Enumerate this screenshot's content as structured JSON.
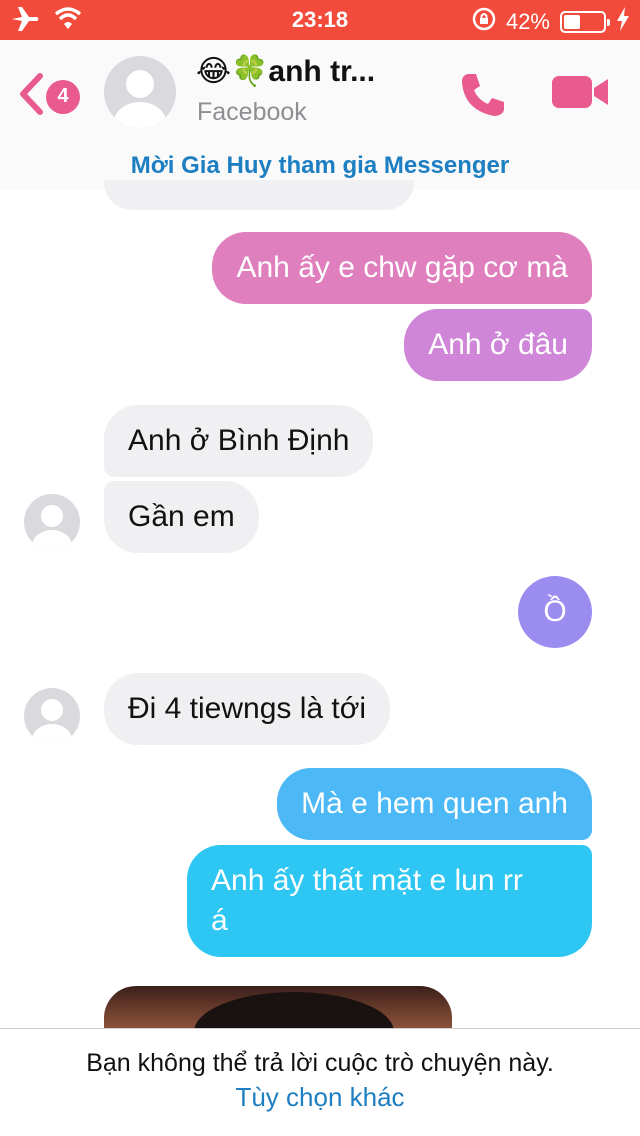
{
  "status_bar": {
    "time": "23:18",
    "battery_text": "42%",
    "battery_level": 0.42,
    "icons": [
      "airplane-icon",
      "wifi-icon",
      "rotation-lock-icon",
      "battery-icon",
      "charging-icon"
    ]
  },
  "header": {
    "back_badge": "4",
    "title": "😂🍀anh tr...",
    "subtitle": "Facebook",
    "accent_color": "#e95a8f"
  },
  "invite_text": "Mời Gia Huy tham gia Messenger",
  "messages": [
    {
      "side": "out",
      "text": "Anh ấy e chw gặp cơ mà",
      "color": "#df7fbd"
    },
    {
      "side": "out",
      "text": "Anh ở đâu",
      "color": "#cf86d8"
    },
    {
      "side": "in",
      "text": "Anh ở Bình Định"
    },
    {
      "side": "in",
      "text": "Gần em"
    },
    {
      "side": "out",
      "text": "Ồ",
      "color": "#9b8df0"
    },
    {
      "side": "in",
      "text": "Đi 4 tiewngs là tới"
    },
    {
      "side": "out",
      "text": "Mà e hem quen anh",
      "color": "#4db8f6"
    },
    {
      "side": "out",
      "text": "Anh ấy thất mặt e lun rr\ná",
      "color": "#2ec6f2"
    }
  ],
  "footer": {
    "notice": "Bạn không thể trả lời cuộc trò chuyện này.",
    "more_options": "Tùy chọn khác"
  }
}
